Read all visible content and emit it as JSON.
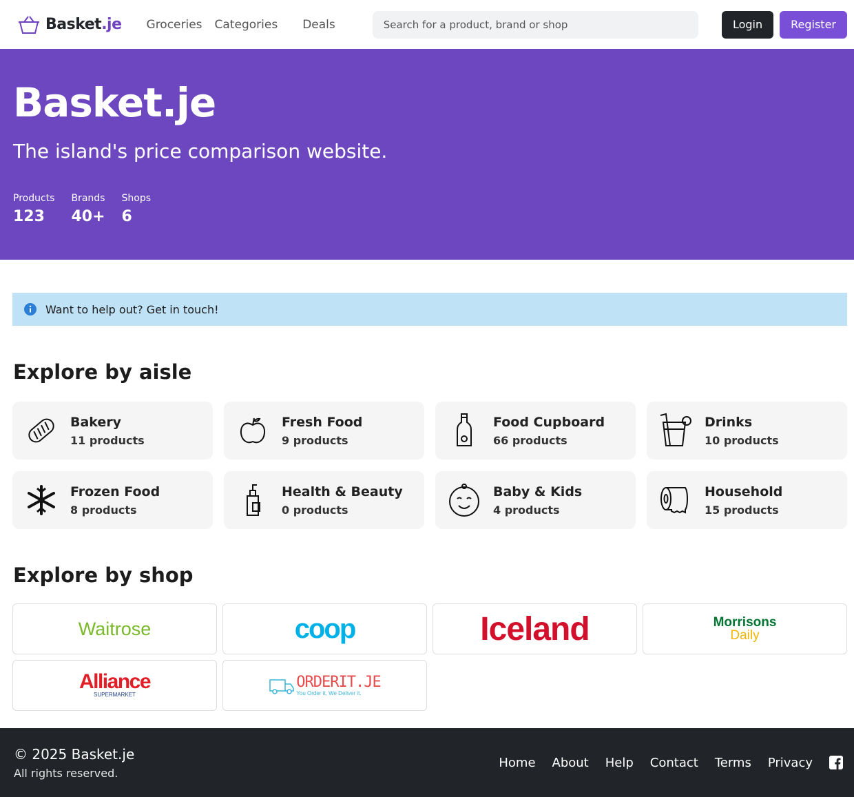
{
  "nav": {
    "brand_main": "Basket",
    "brand_accent": ".je",
    "links": [
      "Groceries",
      "Categories",
      "Deals"
    ],
    "search_placeholder": "Search for a product, brand or shop",
    "login": "Login",
    "register": "Register"
  },
  "hero": {
    "title": "Basket.je",
    "tagline": "The island's price comparison website.",
    "stats": [
      {
        "label": "Products",
        "value": "123"
      },
      {
        "label": "Brands",
        "value": "40+"
      },
      {
        "label": "Shops",
        "value": "6"
      }
    ]
  },
  "alert": {
    "text": "Want to help out? Get in touch!"
  },
  "aisles": {
    "title": "Explore by aisle",
    "items": [
      {
        "name": "Bakery",
        "count": "11 products",
        "icon": "bread-icon"
      },
      {
        "name": "Fresh Food",
        "count": "9 products",
        "icon": "apple-icon"
      },
      {
        "name": "Food Cupboard",
        "count": "66 products",
        "icon": "bottle-icon"
      },
      {
        "name": "Drinks",
        "count": "10 products",
        "icon": "drink-cup-icon"
      },
      {
        "name": "Frozen Food",
        "count": "8 products",
        "icon": "snowflake-icon"
      },
      {
        "name": "Health & Beauty",
        "count": "0 products",
        "icon": "pump-bottle-icon"
      },
      {
        "name": "Baby & Kids",
        "count": "4 products",
        "icon": "baby-face-icon"
      },
      {
        "name": "Household",
        "count": "15 products",
        "icon": "toilet-roll-icon"
      }
    ]
  },
  "shops": {
    "title": "Explore by shop",
    "items": [
      {
        "name": "Waitrose",
        "color": "#7ab929"
      },
      {
        "name": "coop",
        "color": "#00b1e7"
      },
      {
        "name": "Iceland",
        "color": "#d2102b"
      },
      {
        "name": "Morrisons",
        "sub": "Daily",
        "color": "#007531",
        "sub_color": "#f2b500"
      },
      {
        "name": "Alliance",
        "sub": "SUPERMARKET",
        "color": "#e31e26",
        "sub_color": "#1f3d8a"
      },
      {
        "name": "ORDERIT.JE",
        "sub": "You Order it, We Deliver it.",
        "color": "#e74c4c",
        "sub_color": "#3bb6d9"
      }
    ]
  },
  "footer": {
    "copyright": "© 2025 Basket.je",
    "rights": "All rights reserved.",
    "links": [
      "Home",
      "About",
      "Help",
      "Contact",
      "Terms",
      "Privacy"
    ]
  },
  "colors": {
    "primary": "#6c47c0",
    "dark": "#212529",
    "info_bg": "#bfe2f7"
  }
}
